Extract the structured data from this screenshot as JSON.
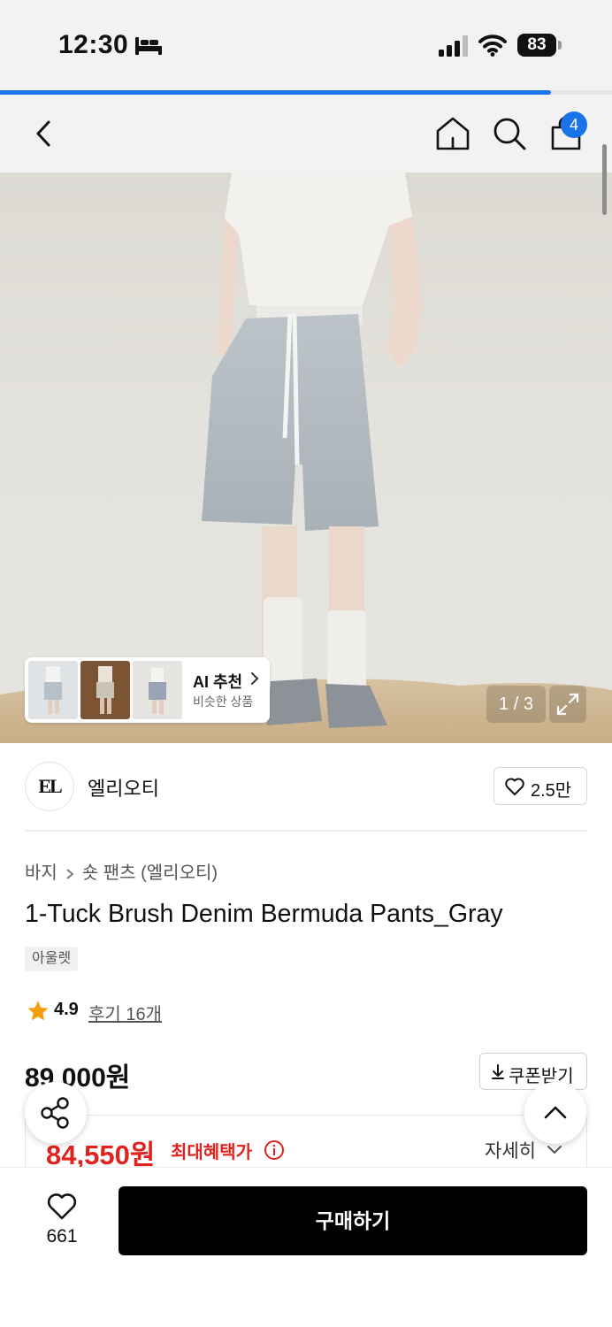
{
  "status_bar": {
    "time": "12:30",
    "battery": "83"
  },
  "page_progress": 0.9,
  "header": {
    "cart_count": "4"
  },
  "gallery": {
    "ai_title": "AI 추천",
    "ai_subtitle": "비슷한 상품",
    "page_indicator": "1 / 3"
  },
  "brand": {
    "logo_text": "EL",
    "name": "엘리오티",
    "like_count": "2.5만"
  },
  "breadcrumb": {
    "category": "바지",
    "subcategory": "숏 팬츠 (엘리오티)"
  },
  "product": {
    "title": "1-Tuck Brush Denim Bermuda Pants_Gray",
    "tag": "아울렛",
    "rating": "4.9",
    "review_link": "후기 16개",
    "price": "89,000원",
    "coupon_label": "쿠폰받기",
    "sale_price": "84,550원",
    "sale_label": "최대혜택가",
    "detail_label": "자세히"
  },
  "bottom_bar": {
    "wish_count": "661",
    "buy_label": "구매하기"
  },
  "colors": {
    "accent": "#1a73e8",
    "sale": "#e0231e",
    "buy_button": "#000000"
  }
}
